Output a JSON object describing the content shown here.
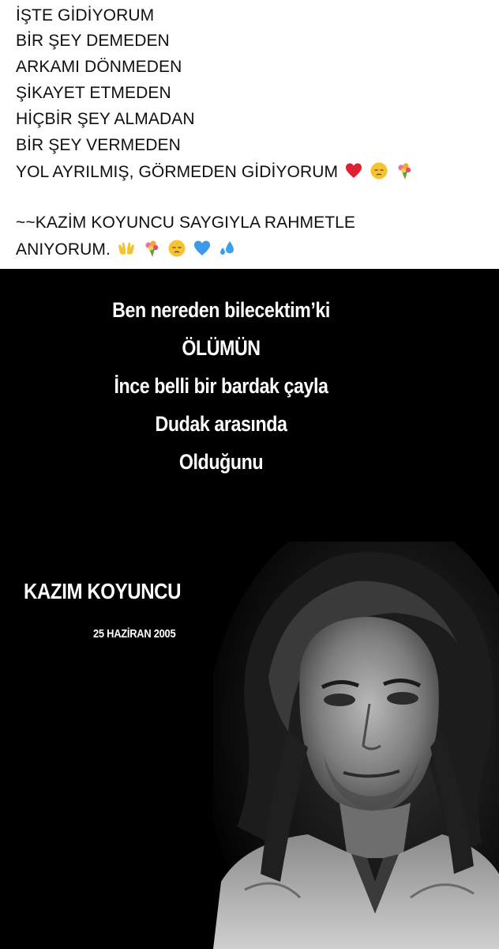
{
  "post": {
    "lines": [
      "İŞTE GİDİYORUM",
      "BİR ŞEY DEMEDEN",
      "ARKAMI DÖNMEDEN",
      "ŞİKAYET ETMEDEN",
      "HİÇBİR ŞEY ALMADAN",
      "BİR ŞEY VERMEDEN",
      "YOL AYRILMIŞ, GÖRMEDEN GİDİYORUM",
      "~~KAZİM KOYUNCU SAYGIYLA RAHMETLE",
      "ANIYORUM."
    ],
    "line7_emojis": [
      "red-heart-icon",
      "pensive-face-icon",
      "bouquet-icon"
    ],
    "line9_emojis": [
      "open-hands-icon",
      "bouquet-icon",
      "pensive-face-icon",
      "blue-heart-icon",
      "sweat-droplets-icon"
    ]
  },
  "poster": {
    "background_color": "#000000",
    "poem": [
      "Ben nereden bilecektim’ki",
      "ÖLÜMÜN",
      "İnce belli bir bardak çayla",
      "Dudak arasında",
      "Olduğunu"
    ],
    "artist_name": "KAZIM KOYUNCU",
    "date": "25 HAZİRAN 2005",
    "portrait_icon": "portrait-photo"
  }
}
